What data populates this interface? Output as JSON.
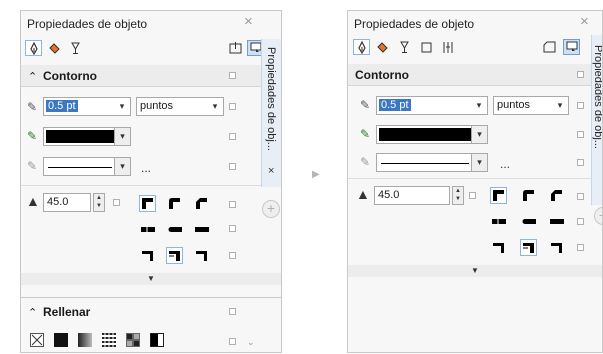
{
  "left_panel": {
    "title": "Propiedades de objeto",
    "close_glyph": "×",
    "dock_label": "Propiedades de obj...",
    "dock_close": "×",
    "contorno": {
      "header": "Contorno",
      "collapse_glyph": "⌃",
      "width_value": "0.5 pt",
      "units_value": "puntos",
      "more_glyph": "...",
      "miter_value": "45.0"
    },
    "rellenar": {
      "header": "Rellenar"
    }
  },
  "right_panel": {
    "title": "Propiedades de objeto",
    "close_glyph": "×",
    "dock_label": "Propiedades de obj...",
    "contorno": {
      "header": "Contorno",
      "width_value": "0.5 pt",
      "units_value": "puntos",
      "more_glyph": "...",
      "miter_value": "45.0"
    }
  },
  "transition_arrow": "▶",
  "icons": {
    "outline_tab": "pen-nib-icon",
    "fill_tab": "paint-bucket-icon",
    "transparency_tab": "wine-glass-icon",
    "frame_tab": "frame-icon",
    "summary_tab": "summary-icon",
    "frame_shape": "frame-shape-icon",
    "panel_dock": "dock-arrow-icon"
  },
  "colors": {
    "panel_bg": "#f7f7f7",
    "header_bg": "#ececec",
    "selection": "#3a78c4",
    "dock_bg": "#e8eef6",
    "accent_border": "#8fb4de"
  }
}
